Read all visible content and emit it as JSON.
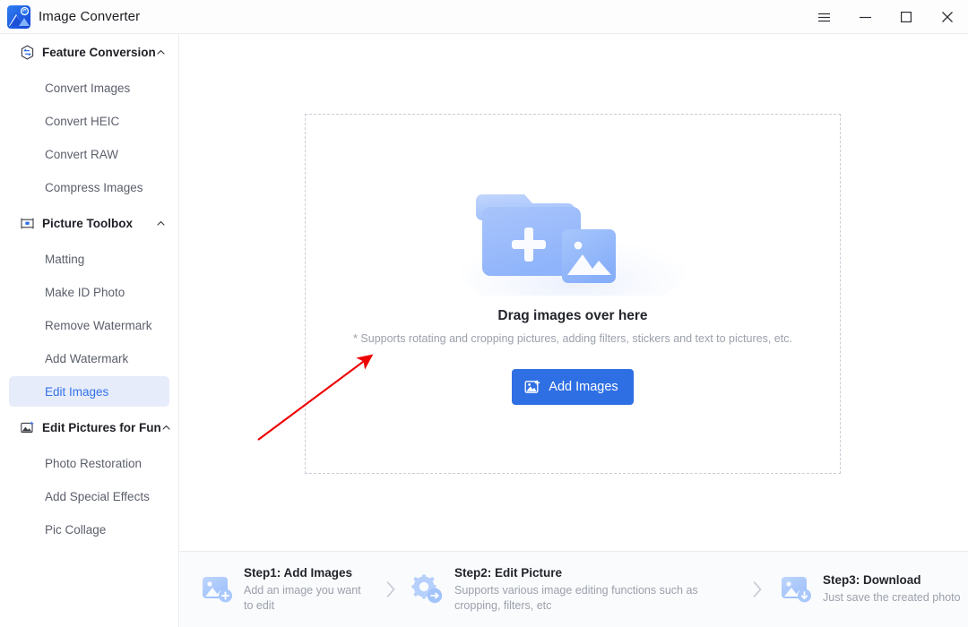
{
  "app": {
    "title": "Image Converter",
    "logo_icon": "image-converter-logo"
  },
  "window_controls": {
    "menu": "menu-icon",
    "minimize": "minimize-icon",
    "maximize": "maximize-icon",
    "close": "close-icon"
  },
  "sidebar": {
    "sections": [
      {
        "label": "Feature Conversion",
        "icon": "hexagon-convert-icon",
        "expanded": true,
        "items": [
          {
            "label": "Convert Images",
            "active": false
          },
          {
            "label": "Convert HEIC",
            "active": false
          },
          {
            "label": "Convert RAW",
            "active": false
          },
          {
            "label": "Compress Images",
            "active": false
          }
        ]
      },
      {
        "label": "Picture Toolbox",
        "icon": "toolbox-icon",
        "expanded": true,
        "items": [
          {
            "label": "Matting",
            "active": false
          },
          {
            "label": "Make ID Photo",
            "active": false
          },
          {
            "label": "Remove Watermark",
            "active": false
          },
          {
            "label": "Add Watermark",
            "active": false
          },
          {
            "label": "Edit Images",
            "active": true
          }
        ]
      },
      {
        "label": "Edit Pictures for Fun",
        "icon": "photo-sparkle-icon",
        "expanded": true,
        "items": [
          {
            "label": "Photo Restoration",
            "active": false
          },
          {
            "label": "Add Special Effects",
            "active": false
          },
          {
            "label": "Pic Collage",
            "active": false
          }
        ]
      }
    ]
  },
  "dropzone": {
    "illustration": "folder-add-image-illustration",
    "title": "Drag images over here",
    "subtitle": "* Supports rotating and cropping pictures, adding filters, stickers and text to pictures, etc.",
    "button_label": "Add Images",
    "button_icon": "add-image-icon"
  },
  "annotation": {
    "arrow_color": "#ee0000",
    "description": "red-arrow-pointing-to-dropzone"
  },
  "steps": [
    {
      "title": "Step1:  Add Images",
      "desc": "Add an image you want to edit",
      "icon": "add-photo-icon"
    },
    {
      "title": "Step2:  Edit Picture",
      "desc": "Supports various image editing functions such as cropping, filters, etc",
      "icon": "gear-edit-icon"
    },
    {
      "title": "Step3:  Download",
      "desc": "Just save the created photo",
      "icon": "download-photo-icon"
    }
  ],
  "colors": {
    "accent": "#2f6fe4",
    "active_item_bg": "#e7ecfb",
    "active_item_text": "#3272ea",
    "muted_text": "#9ba0ab",
    "border": "#e9ebef"
  }
}
